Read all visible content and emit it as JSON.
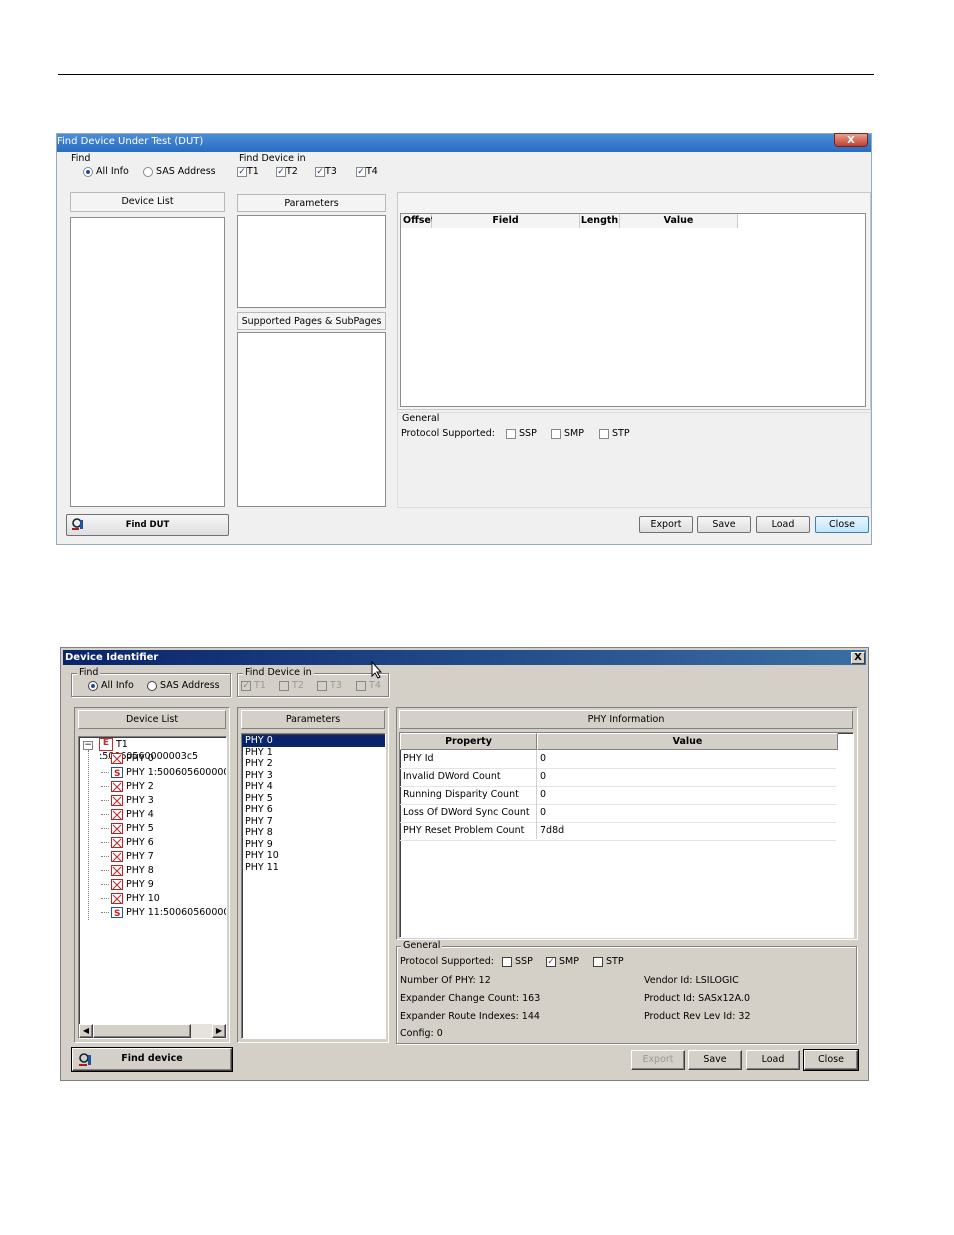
{
  "dialog1": {
    "title": "Find Device Under Test (DUT)",
    "close_glyph": "X",
    "find_label": "Find",
    "radio_all_info": "All Info",
    "radio_sas_address": "SAS Address",
    "find_in_label": "Find Device in",
    "targets": [
      "T1",
      "T2",
      "T3",
      "T4"
    ],
    "device_list_header": "Device List",
    "parameters_header": "Parameters",
    "supported_pages_header": "Supported Pages & SubPages",
    "columns": [
      "Offset",
      "Field",
      "Length",
      "Value"
    ],
    "general_label": "General",
    "protocol_label": "Protocol Supported:",
    "protocols": [
      "SSP",
      "SMP",
      "STP"
    ],
    "find_button": "Find DUT",
    "buttons": {
      "export": "Export",
      "save": "Save",
      "load": "Load",
      "close": "Close"
    }
  },
  "dialog2": {
    "title": "Device Identifier",
    "close_glyph": "X",
    "find_label": "Find",
    "radio_all_info": "All Info",
    "radio_sas_address": "SAS Address",
    "find_in_label": "Find Device in",
    "targets": [
      "T1",
      "T2",
      "T3",
      "T4"
    ],
    "device_list_header": "Device List",
    "tree": {
      "root": "T1 :50060560000003c5",
      "children": [
        "PHY 0",
        "PHY 1:500605600000",
        "PHY 2",
        "PHY 3",
        "PHY 4",
        "PHY 5",
        "PHY 6",
        "PHY 7",
        "PHY 8",
        "PHY 9",
        "PHY 10",
        "PHY 11:500605600000"
      ]
    },
    "parameters_header": "Parameters",
    "parameters": [
      "PHY 0",
      "PHY 1",
      "PHY 2",
      "PHY 3",
      "PHY 4",
      "PHY 5",
      "PHY 6",
      "PHY 7",
      "PHY 8",
      "PHY 9",
      "PHY 10",
      "PHY 11"
    ],
    "selected_parameter": "PHY 0",
    "phy_info_header": "PHY Information",
    "table_columns": {
      "property": "Property",
      "value": "Value"
    },
    "rows": [
      {
        "property": "PHY Id",
        "value": "0"
      },
      {
        "property": "Invalid DWord Count",
        "value": "0"
      },
      {
        "property": "Running Disparity Count",
        "value": "0"
      },
      {
        "property": "Loss Of DWord Sync Count",
        "value": "0"
      },
      {
        "property": "PHY Reset Problem Count",
        "value": "7d8d"
      }
    ],
    "general_label": "General",
    "protocol_label": "Protocol Supported:",
    "protocols": [
      "SSP",
      "SMP",
      "STP"
    ],
    "protocol_checked": [
      false,
      true,
      false
    ],
    "number_of_phy": "Number Of PHY: 12",
    "expander_change_count": "Expander Change Count: 163",
    "expander_route_indexes": "Expander Route Indexes: 144",
    "config": "Config: 0",
    "vendor_id": "Vendor Id: LSILOGIC",
    "product_id": "Product Id: SASx12A.0",
    "product_rev": "Product Rev Lev Id: 32",
    "find_button": "Find device",
    "buttons": {
      "export": "Export",
      "save": "Save",
      "load": "Load",
      "close": "Close"
    }
  }
}
